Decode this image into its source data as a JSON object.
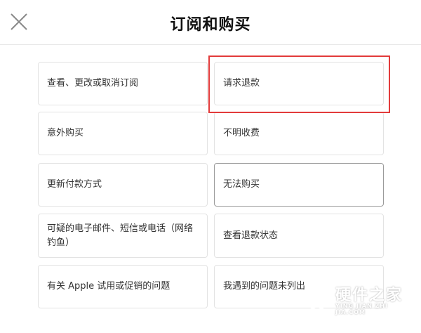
{
  "header": {
    "title": "订阅和购买",
    "close_icon": "close-icon"
  },
  "options": {
    "manage_subscription": "查看、更改或取消订阅",
    "request_refund": "请求退款",
    "accidental_purchase": "意外购买",
    "unknown_charge": "不明收费",
    "update_payment": "更新付款方式",
    "cannot_purchase": "无法购买",
    "suspicious_email": "可疑的电子邮件、短信或电话（网络钓鱼）",
    "check_refund_status": "查看退款状态",
    "apple_trial": "有关 Apple 试用或促销的问题",
    "issue_not_listed": "我遇到的问题未列出"
  },
  "highlight": {
    "color": "#e23b3b",
    "target": "请求退款"
  },
  "watermark": {
    "name": "硬件之家",
    "sub": "YING JIAN ZHI JIA.COM"
  }
}
